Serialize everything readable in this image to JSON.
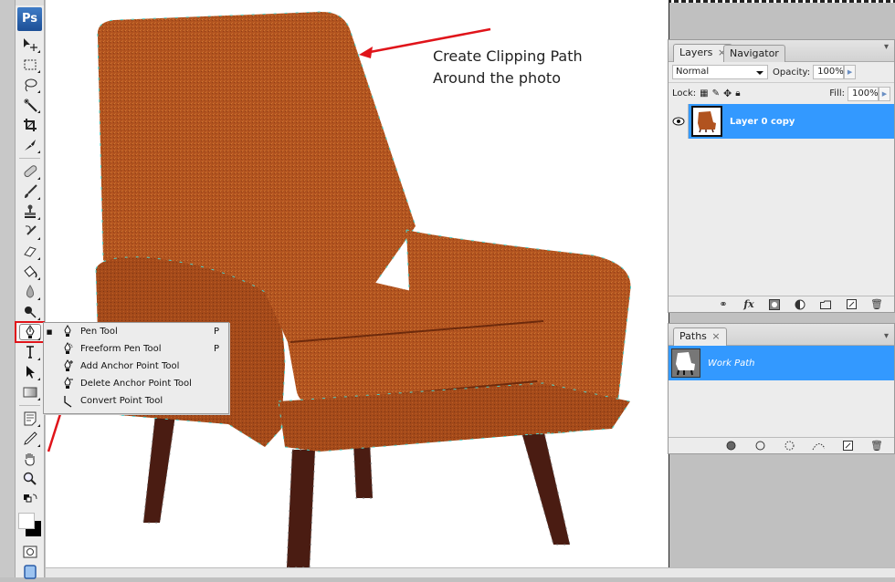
{
  "app": {
    "logo": "Ps"
  },
  "toolbar": {
    "tools": [
      {
        "name": "move-tool",
        "glyph": "move"
      },
      {
        "name": "marquee-tool",
        "glyph": "marquee"
      },
      {
        "name": "lasso-tool",
        "glyph": "lasso"
      },
      {
        "name": "magic-wand-tool",
        "glyph": "wand"
      },
      {
        "name": "crop-tool",
        "glyph": "crop"
      },
      {
        "name": "slice-tool",
        "glyph": "slice"
      },
      {
        "name": "healing-brush-tool",
        "glyph": "bandage"
      },
      {
        "name": "brush-tool",
        "glyph": "brush"
      },
      {
        "name": "clone-stamp-tool",
        "glyph": "stamp"
      },
      {
        "name": "history-brush-tool",
        "glyph": "history"
      },
      {
        "name": "eraser-tool",
        "glyph": "eraser"
      },
      {
        "name": "paint-bucket-tool",
        "glyph": "bucket"
      },
      {
        "name": "blur-tool",
        "glyph": "drop"
      },
      {
        "name": "dodge-tool",
        "glyph": "dodge"
      },
      {
        "name": "pen-tool",
        "glyph": "pen",
        "active": true
      },
      {
        "name": "type-tool",
        "glyph": "type"
      },
      {
        "name": "path-selection-tool",
        "glyph": "arrow"
      },
      {
        "name": "rectangle-tool",
        "glyph": "rect"
      },
      {
        "name": "notes-tool",
        "glyph": "note"
      },
      {
        "name": "eyedropper-tool",
        "glyph": "eyedropper"
      },
      {
        "name": "hand-tool",
        "glyph": "hand"
      },
      {
        "name": "zoom-tool",
        "glyph": "zoom"
      }
    ],
    "foreground_color": "#ffffff",
    "background_color": "#000000"
  },
  "flyout_menu": {
    "items": [
      {
        "label": "Pen Tool",
        "shortcut": "P",
        "selected": true
      },
      {
        "label": "Freeform Pen Tool",
        "shortcut": "P",
        "selected": false
      },
      {
        "label": "Add Anchor Point Tool",
        "shortcut": "",
        "selected": false
      },
      {
        "label": "Delete Anchor Point Tool",
        "shortcut": "",
        "selected": false
      },
      {
        "label": "Convert Point Tool",
        "shortcut": "",
        "selected": false
      }
    ]
  },
  "annotation": {
    "line1": "Create Clipping Path",
    "line2": "Around the photo",
    "arrow_color": "#e0141a"
  },
  "layers_panel": {
    "tabs": [
      {
        "label": "Layers",
        "close": "×"
      },
      {
        "label": "Navigator"
      }
    ],
    "blend_mode": "Normal",
    "opacity_label": "Opacity:",
    "opacity_value": "100%",
    "lock_label": "Lock:",
    "fill_label": "Fill:",
    "fill_value": "100%",
    "layers": [
      {
        "name": "Layer 0 copy",
        "visible": true,
        "selected": true
      }
    ],
    "selection_color": "#3399ff"
  },
  "paths_panel": {
    "tabs": [
      {
        "label": "Paths",
        "close": "×"
      }
    ],
    "paths": [
      {
        "name": "Work Path",
        "selected": true
      }
    ]
  }
}
